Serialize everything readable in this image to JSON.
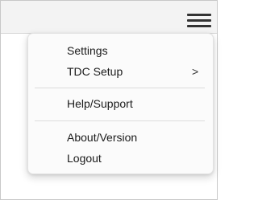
{
  "header": {
    "menu_icon": "hamburger-menu-icon"
  },
  "menu": {
    "items": [
      {
        "label": "Settings"
      },
      {
        "label": "TDC Setup",
        "submenu_icon": "chevron-right-icon",
        "chevron": ">"
      },
      {
        "label": "Help/Support"
      },
      {
        "label": "About/Version"
      },
      {
        "label": "Logout"
      }
    ]
  },
  "colors": {
    "topbar_bg": "#f3f3f3",
    "menu_bg": "#fbfbfb",
    "text": "#1a1a1a",
    "separator": "#dcdcdc"
  }
}
